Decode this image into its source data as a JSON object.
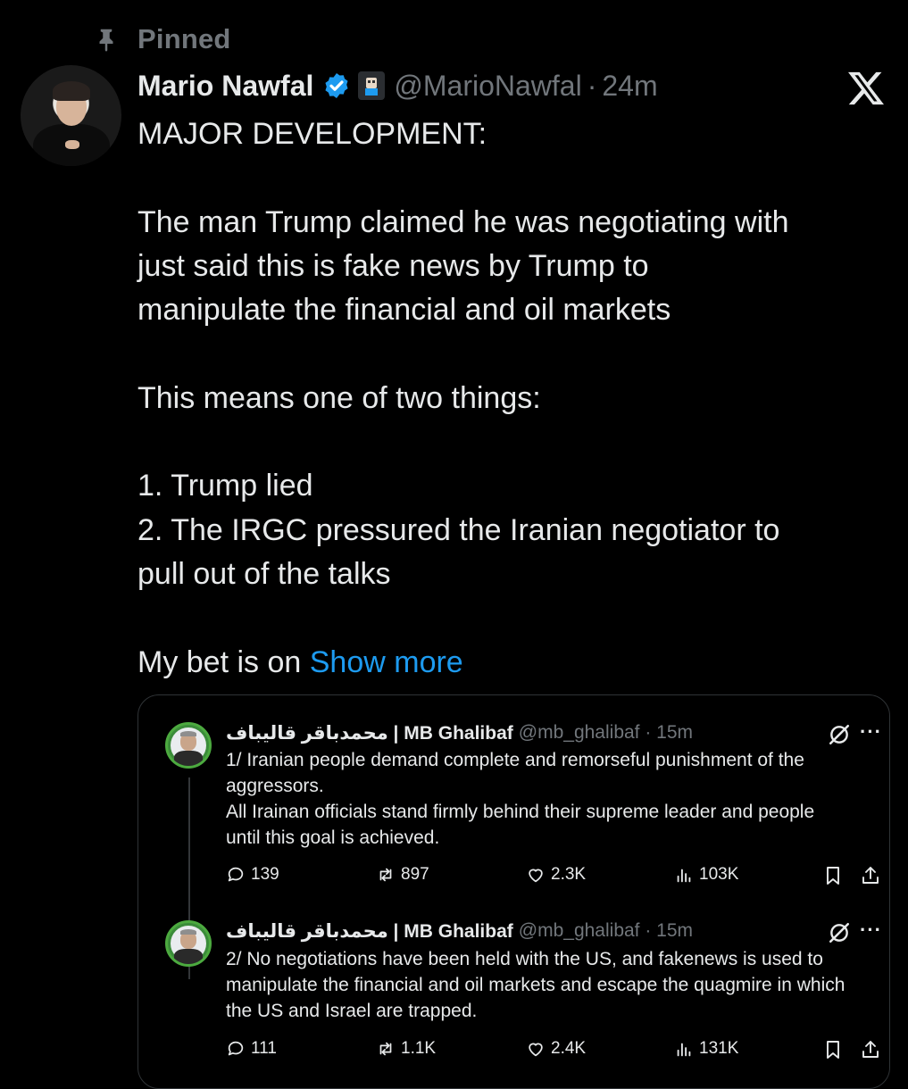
{
  "pinned": {
    "label": "Pinned"
  },
  "post": {
    "author_name": "Mario Nawfal",
    "handle": "@MarioNawfal",
    "separator": "·",
    "time": "24m",
    "body_lines": [
      "MAJOR DEVELOPMENT:",
      "",
      "The man Trump claimed he was negotiating with",
      "just said this is fake news by Trump to",
      "manipulate the financial and oil markets",
      "",
      "This means one of two things:",
      "",
      "1. Trump lied",
      "2. The IRGC pressured the Iranian negotiator to",
      "pull out of the talks",
      "",
      "My bet is on "
    ],
    "show_more": "Show more"
  },
  "quote": {
    "tweets": [
      {
        "author_name": "محمدباقر قالیباف | MB Ghalibaf",
        "handle": "@mb_ghalibaf · 15m",
        "text_lines": [
          "1/ Iranian people demand complete and remorseful punishment of the",
          "aggressors.",
          "All Irainan officials stand firmly behind their supreme leader and people",
          "until this goal is achieved."
        ],
        "replies": "139",
        "reposts": "897",
        "likes": "2.3K",
        "views": "103K"
      },
      {
        "author_name": "محمدباقر قالیباف | MB Ghalibaf",
        "handle": "@mb_ghalibaf · 15m",
        "text_lines": [
          "2/ No negotiations have been held with the US, and fakenews is used to",
          "manipulate the financial and oil markets and escape the quagmire in which",
          "the US and Israel are trapped."
        ],
        "replies": "111",
        "reposts": "1.1K",
        "likes": "2.4K",
        "views": "131K"
      }
    ],
    "more_label": "···"
  },
  "colors": {
    "background": "#000000",
    "text": "#e7e9ea",
    "muted": "#71767b",
    "link": "#1d9bf0",
    "verified": "#1d9bf0"
  }
}
